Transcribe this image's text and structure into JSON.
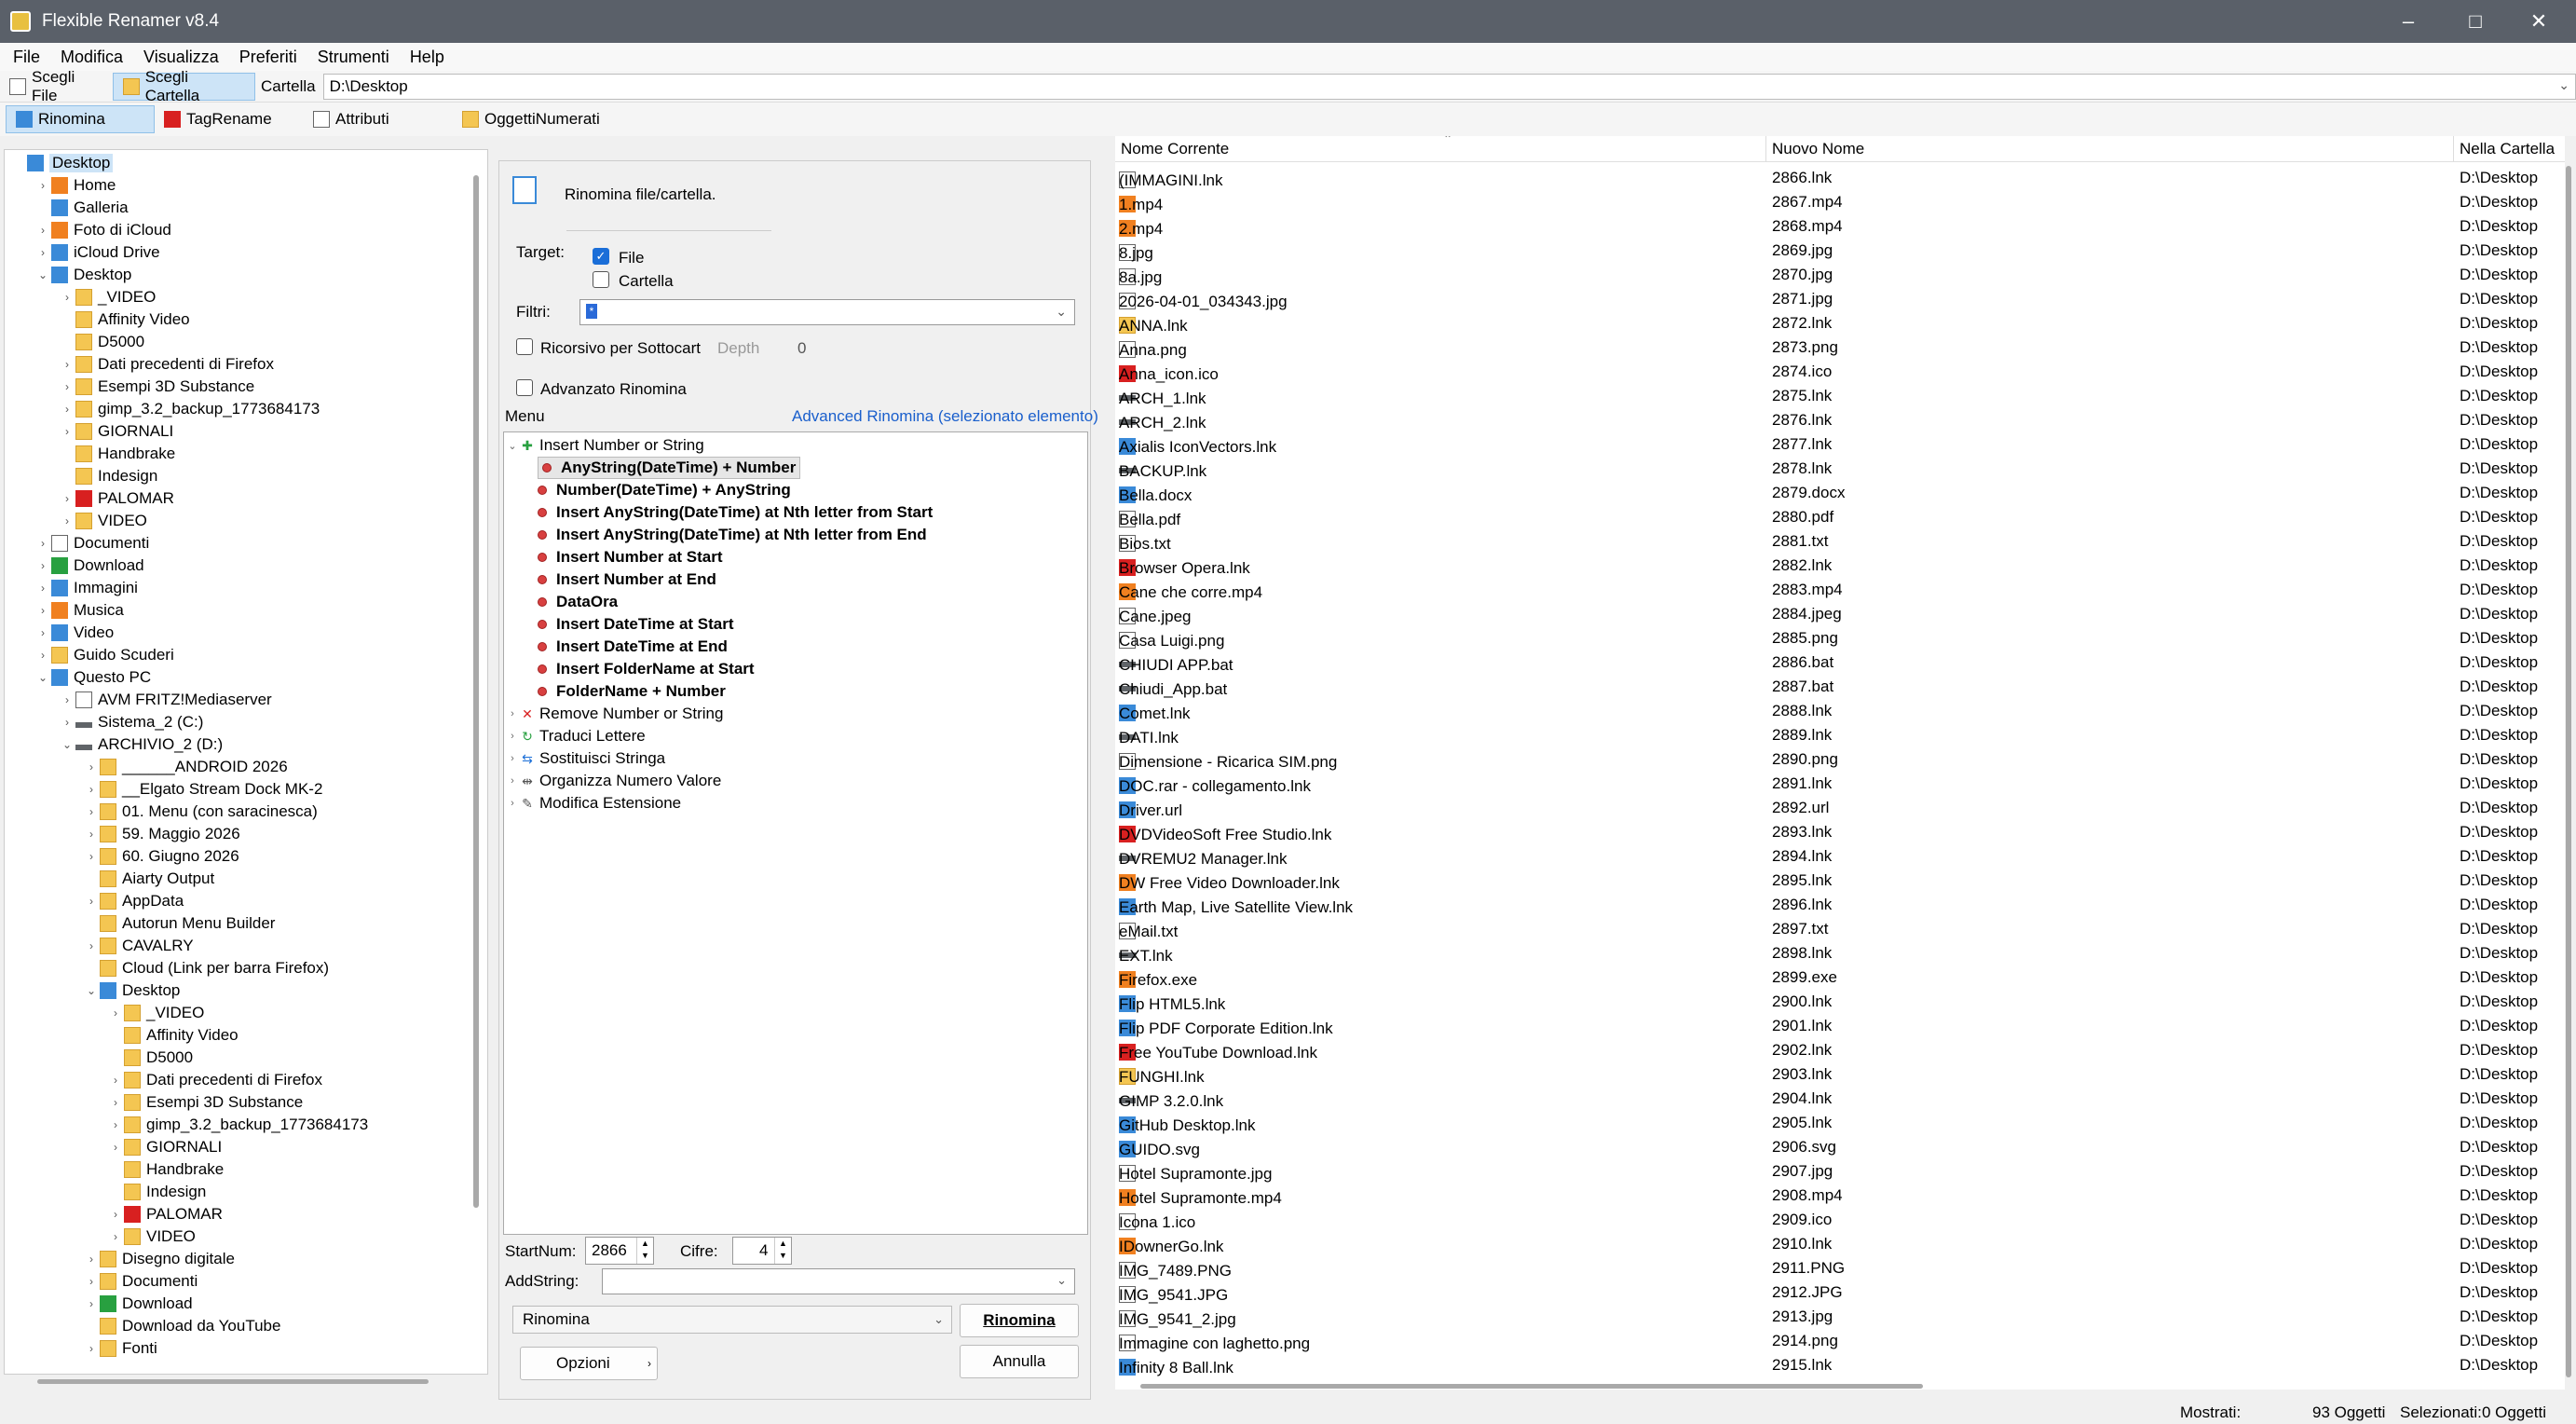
{
  "window": {
    "title": "Flexible Renamer v8.4"
  },
  "menubar": [
    "File",
    "Modifica",
    "Visualizza",
    "Preferiti",
    "Strumenti",
    "Help"
  ],
  "toolbar": {
    "scegli_file": "Scegli File",
    "scegli_cartella": "Scegli Cartella",
    "cartella_label": "Cartella",
    "cartella_value": "D:\\Desktop"
  },
  "tabs": [
    "Rinomina",
    "TagRename",
    "Attributi",
    "OggettiNumerati"
  ],
  "tree": [
    {
      "label": "Desktop",
      "level": 0,
      "exp": "",
      "icon": "blue",
      "selected": true
    },
    {
      "label": "Home",
      "level": 1,
      "exp": "›",
      "icon": "orange"
    },
    {
      "label": "Galleria",
      "level": 1,
      "exp": "",
      "icon": "blue"
    },
    {
      "label": "Foto di iCloud",
      "level": 1,
      "exp": "›",
      "icon": "orange"
    },
    {
      "label": "iCloud Drive",
      "level": 1,
      "exp": "›",
      "icon": "blue"
    },
    {
      "label": "Desktop",
      "level": 1,
      "exp": "⌄",
      "icon": "blue"
    },
    {
      "label": "_VIDEO",
      "level": 2,
      "exp": "›",
      "icon": "fold"
    },
    {
      "label": "Affinity Video",
      "level": 2,
      "exp": "",
      "icon": "fold"
    },
    {
      "label": "D5000",
      "level": 2,
      "exp": "",
      "icon": "fold"
    },
    {
      "label": "Dati precedenti di Firefox",
      "level": 2,
      "exp": "›",
      "icon": "fold"
    },
    {
      "label": "Esempi 3D Substance",
      "level": 2,
      "exp": "›",
      "icon": "fold"
    },
    {
      "label": "gimp_3.2_backup_1773684173",
      "level": 2,
      "exp": "›",
      "icon": "fold"
    },
    {
      "label": "GIORNALI",
      "level": 2,
      "exp": "›",
      "icon": "fold"
    },
    {
      "label": "Handbrake",
      "level": 2,
      "exp": "",
      "icon": "fold"
    },
    {
      "label": "Indesign",
      "level": 2,
      "exp": "",
      "icon": "fold"
    },
    {
      "label": "PALOMAR",
      "level": 2,
      "exp": "›",
      "icon": "red"
    },
    {
      "label": "VIDEO",
      "level": 2,
      "exp": "›",
      "icon": "fold"
    },
    {
      "label": "Documenti",
      "level": 1,
      "exp": "›",
      "icon": "doc"
    },
    {
      "label": "Download",
      "level": 1,
      "exp": "›",
      "icon": "green"
    },
    {
      "label": "Immagini",
      "level": 1,
      "exp": "›",
      "icon": "blue"
    },
    {
      "label": "Musica",
      "level": 1,
      "exp": "›",
      "icon": "orange"
    },
    {
      "label": "Video",
      "level": 1,
      "exp": "›",
      "icon": "blue"
    },
    {
      "label": "Guido Scuderi",
      "level": 1,
      "exp": "›",
      "icon": "fold"
    },
    {
      "label": "Questo PC",
      "level": 1,
      "exp": "⌄",
      "icon": "blue"
    },
    {
      "label": "AVM FRITZ!Mediaserver",
      "level": 2,
      "exp": "›",
      "icon": "doc"
    },
    {
      "label": "Sistema_2 (C:)",
      "level": 2,
      "exp": "›",
      "icon": "gray"
    },
    {
      "label": "ARCHIVIO_2 (D:)",
      "level": 2,
      "exp": "⌄",
      "icon": "gray"
    },
    {
      "label": "______ANDROID 2026",
      "level": 3,
      "exp": "›",
      "icon": "fold"
    },
    {
      "label": "__Elgato Stream Dock MK-2",
      "level": 3,
      "exp": "›",
      "icon": "fold"
    },
    {
      "label": "01. Menu (con saracinesca)",
      "level": 3,
      "exp": "›",
      "icon": "fold"
    },
    {
      "label": "59. Maggio 2026",
      "level": 3,
      "exp": "›",
      "icon": "fold"
    },
    {
      "label": "60. Giugno 2026",
      "level": 3,
      "exp": "›",
      "icon": "fold"
    },
    {
      "label": "Aiarty Output",
      "level": 3,
      "exp": "",
      "icon": "fold"
    },
    {
      "label": "AppData",
      "level": 3,
      "exp": "›",
      "icon": "fold"
    },
    {
      "label": "Autorun Menu Builder",
      "level": 3,
      "exp": "",
      "icon": "fold"
    },
    {
      "label": "CAVALRY",
      "level": 3,
      "exp": "›",
      "icon": "fold"
    },
    {
      "label": "Cloud (Link per barra Firefox)",
      "level": 3,
      "exp": "",
      "icon": "fold"
    },
    {
      "label": "Desktop",
      "level": 3,
      "exp": "⌄",
      "icon": "blue"
    },
    {
      "label": "_VIDEO",
      "level": 4,
      "exp": "›",
      "icon": "fold"
    },
    {
      "label": "Affinity Video",
      "level": 4,
      "exp": "",
      "icon": "fold"
    },
    {
      "label": "D5000",
      "level": 4,
      "exp": "",
      "icon": "fold"
    },
    {
      "label": "Dati precedenti di Firefox",
      "level": 4,
      "exp": "›",
      "icon": "fold"
    },
    {
      "label": "Esempi 3D Substance",
      "level": 4,
      "exp": "›",
      "icon": "fold"
    },
    {
      "label": "gimp_3.2_backup_1773684173",
      "level": 4,
      "exp": "›",
      "icon": "fold"
    },
    {
      "label": "GIORNALI",
      "level": 4,
      "exp": "›",
      "icon": "fold"
    },
    {
      "label": "Handbrake",
      "level": 4,
      "exp": "",
      "icon": "fold"
    },
    {
      "label": "Indesign",
      "level": 4,
      "exp": "",
      "icon": "fold"
    },
    {
      "label": "PALOMAR",
      "level": 4,
      "exp": "›",
      "icon": "red"
    },
    {
      "label": "VIDEO",
      "level": 4,
      "exp": "›",
      "icon": "fold"
    },
    {
      "label": "Disegno digitale",
      "level": 3,
      "exp": "›",
      "icon": "fold"
    },
    {
      "label": "Documenti",
      "level": 3,
      "exp": "›",
      "icon": "fold"
    },
    {
      "label": "Download",
      "level": 3,
      "exp": "›",
      "icon": "green"
    },
    {
      "label": "Download da YouTube",
      "level": 3,
      "exp": "",
      "icon": "fold"
    },
    {
      "label": "Fonti",
      "level": 3,
      "exp": "›",
      "icon": "fold"
    }
  ],
  "rename": {
    "header": "Rinomina file/cartella.",
    "target_label": "Target:",
    "file_label": "File",
    "cartella_label": "Cartella",
    "filtri_label": "Filtri:",
    "filtri_value": "*",
    "ricorsivo_label": "Ricorsivo per Sottocarte",
    "depth_label": "Depth",
    "depth_value": "0",
    "avanzato_label": "Advanzato Rinomina",
    "menu_label": "Menu",
    "advanced_link": "Advanced Rinomina (selezionato elemento)",
    "startnum_label": "StartNum:",
    "startnum_value": "2866",
    "cifre_label": "Cifre:",
    "cifre_value": "4",
    "addstring_label": "AddString:",
    "mode_value": "Rinomina",
    "rinomina_button": "Rinomina",
    "opzioni_button": "Opzioni",
    "annulla_button": "Annulla"
  },
  "menu_tree": [
    {
      "label": "Insert Number or String",
      "level": 0,
      "exp": "⌄",
      "bold": false,
      "icon": "plus"
    },
    {
      "label": "AnyString(DateTime) + Number",
      "level": 1,
      "bold": true,
      "hl": true
    },
    {
      "label": "Number(DateTime) + AnyString",
      "level": 1,
      "bold": true
    },
    {
      "label": "Insert AnyString(DateTime) at Nth letter from Start",
      "level": 1,
      "bold": true
    },
    {
      "label": "Insert AnyString(DateTime) at Nth letter from End",
      "level": 1,
      "bold": true
    },
    {
      "label": "Insert Number at Start",
      "level": 1,
      "bold": true
    },
    {
      "label": "Insert Number at End",
      "level": 1,
      "bold": true
    },
    {
      "label": "DataOra",
      "level": 1,
      "bold": true
    },
    {
      "label": "Insert DateTime at Start",
      "level": 1,
      "bold": true
    },
    {
      "label": "Insert DateTime at End",
      "level": 1,
      "bold": true
    },
    {
      "label": "Insert FolderName at Start",
      "level": 1,
      "bold": true
    },
    {
      "label": "FolderName + Number",
      "level": 1,
      "bold": true
    },
    {
      "label": "Remove Number or String",
      "level": 0,
      "exp": "›",
      "icon": "x"
    },
    {
      "label": "Traduci Lettere",
      "level": 0,
      "exp": "›",
      "icon": "cycle"
    },
    {
      "label": "Sostituisci Stringa",
      "level": 0,
      "exp": "›",
      "icon": "swap"
    },
    {
      "label": "Organizza Numero Valore",
      "level": 0,
      "exp": "›",
      "icon": "bars"
    },
    {
      "label": "Modifica Estensione",
      "level": 0,
      "exp": "›",
      "icon": "pen"
    }
  ],
  "list": {
    "columns": [
      "Nome Corrente",
      "Nuovo Nome",
      "Nella Cartella"
    ],
    "rows": [
      [
        "(IMMAGINI.lnk",
        "2866.lnk",
        "D:\\Desktop",
        "doc"
      ],
      [
        "1.mp4",
        "2867.mp4",
        "D:\\Desktop",
        "orange"
      ],
      [
        "2.mp4",
        "2868.mp4",
        "D:\\Desktop",
        "orange"
      ],
      [
        "8.jpg",
        "2869.jpg",
        "D:\\Desktop",
        "doc"
      ],
      [
        "8a.jpg",
        "2870.jpg",
        "D:\\Desktop",
        "doc"
      ],
      [
        "2026-04-01_034343.jpg",
        "2871.jpg",
        "D:\\Desktop",
        "doc"
      ],
      [
        "ANNA.lnk",
        "2872.lnk",
        "D:\\Desktop",
        "fold"
      ],
      [
        "Anna.png",
        "2873.png",
        "D:\\Desktop",
        "doc"
      ],
      [
        "Anna_icon.ico",
        "2874.ico",
        "D:\\Desktop",
        "red"
      ],
      [
        "ARCH_1.lnk",
        "2875.lnk",
        "D:\\Desktop",
        "gray"
      ],
      [
        "ARCH_2.lnk",
        "2876.lnk",
        "D:\\Desktop",
        "gray"
      ],
      [
        "Axialis IconVectors.lnk",
        "2877.lnk",
        "D:\\Desktop",
        "blue"
      ],
      [
        "BACKUP.lnk",
        "2878.lnk",
        "D:\\Desktop",
        "gray"
      ],
      [
        "Bella.docx",
        "2879.docx",
        "D:\\Desktop",
        "blue"
      ],
      [
        "Bella.pdf",
        "2880.pdf",
        "D:\\Desktop",
        "doc"
      ],
      [
        "Bios.txt",
        "2881.txt",
        "D:\\Desktop",
        "doc"
      ],
      [
        "Browser Opera.lnk",
        "2882.lnk",
        "D:\\Desktop",
        "red"
      ],
      [
        "Cane che corre.mp4",
        "2883.mp4",
        "D:\\Desktop",
        "orange"
      ],
      [
        "Cane.jpeg",
        "2884.jpeg",
        "D:\\Desktop",
        "doc"
      ],
      [
        "Casa Luigi.png",
        "2885.png",
        "D:\\Desktop",
        "doc"
      ],
      [
        "CHIUDI APP.bat",
        "2886.bat",
        "D:\\Desktop",
        "gray"
      ],
      [
        "Chiudi_App.bat",
        "2887.bat",
        "D:\\Desktop",
        "gray"
      ],
      [
        "Comet.lnk",
        "2888.lnk",
        "D:\\Desktop",
        "blue"
      ],
      [
        "DATI.lnk",
        "2889.lnk",
        "D:\\Desktop",
        "gray"
      ],
      [
        "Dimensione - Ricarica SIM.png",
        "2890.png",
        "D:\\Desktop",
        "doc"
      ],
      [
        "DOC.rar - collegamento.lnk",
        "2891.lnk",
        "D:\\Desktop",
        "blue"
      ],
      [
        "Driver.url",
        "2892.url",
        "D:\\Desktop",
        "blue"
      ],
      [
        "DVDVideoSoft Free Studio.lnk",
        "2893.lnk",
        "D:\\Desktop",
        "red"
      ],
      [
        "DVREMU2 Manager.lnk",
        "2894.lnk",
        "D:\\Desktop",
        "gray"
      ],
      [
        "DW Free Video Downloader.lnk",
        "2895.lnk",
        "D:\\Desktop",
        "orange"
      ],
      [
        "Earth Map, Live Satellite View.lnk",
        "2896.lnk",
        "D:\\Desktop",
        "blue"
      ],
      [
        "eMail.txt",
        "2897.txt",
        "D:\\Desktop",
        "doc"
      ],
      [
        "EXT.lnk",
        "2898.lnk",
        "D:\\Desktop",
        "gray"
      ],
      [
        "Firefox.exe",
        "2899.exe",
        "D:\\Desktop",
        "orange"
      ],
      [
        "Flip HTML5.lnk",
        "2900.lnk",
        "D:\\Desktop",
        "blue"
      ],
      [
        "Flip PDF Corporate Edition.lnk",
        "2901.lnk",
        "D:\\Desktop",
        "blue"
      ],
      [
        "Free YouTube Download.lnk",
        "2902.lnk",
        "D:\\Desktop",
        "red"
      ],
      [
        "FUNGHI.lnk",
        "2903.lnk",
        "D:\\Desktop",
        "fold"
      ],
      [
        "GIMP 3.2.0.lnk",
        "2904.lnk",
        "D:\\Desktop",
        "gray"
      ],
      [
        "GitHub Desktop.lnk",
        "2905.lnk",
        "D:\\Desktop",
        "blue"
      ],
      [
        "GUIDO.svg",
        "2906.svg",
        "D:\\Desktop",
        "blue"
      ],
      [
        "Hotel Supramonte.jpg",
        "2907.jpg",
        "D:\\Desktop",
        "doc"
      ],
      [
        "Hotel Supramonte.mp4",
        "2908.mp4",
        "D:\\Desktop",
        "orange"
      ],
      [
        "Icona 1.ico",
        "2909.ico",
        "D:\\Desktop",
        "doc"
      ],
      [
        "IDownerGo.lnk",
        "2910.lnk",
        "D:\\Desktop",
        "orange"
      ],
      [
        "IMG_7489.PNG",
        "2911.PNG",
        "D:\\Desktop",
        "doc"
      ],
      [
        "IMG_9541.JPG",
        "2912.JPG",
        "D:\\Desktop",
        "doc"
      ],
      [
        "IMG_9541_2.jpg",
        "2913.jpg",
        "D:\\Desktop",
        "doc"
      ],
      [
        "Immagine con laghetto.png",
        "2914.png",
        "D:\\Desktop",
        "doc"
      ],
      [
        "Infinity 8 Ball.lnk",
        "2915.lnk",
        "D:\\Desktop",
        "blue"
      ]
    ]
  },
  "status": {
    "mostrati_label": "Mostrati:",
    "mostrati_value": "93 Oggetti",
    "selezionati_label": "Selezionati:",
    "selezionati_value": "0 Oggetti"
  }
}
